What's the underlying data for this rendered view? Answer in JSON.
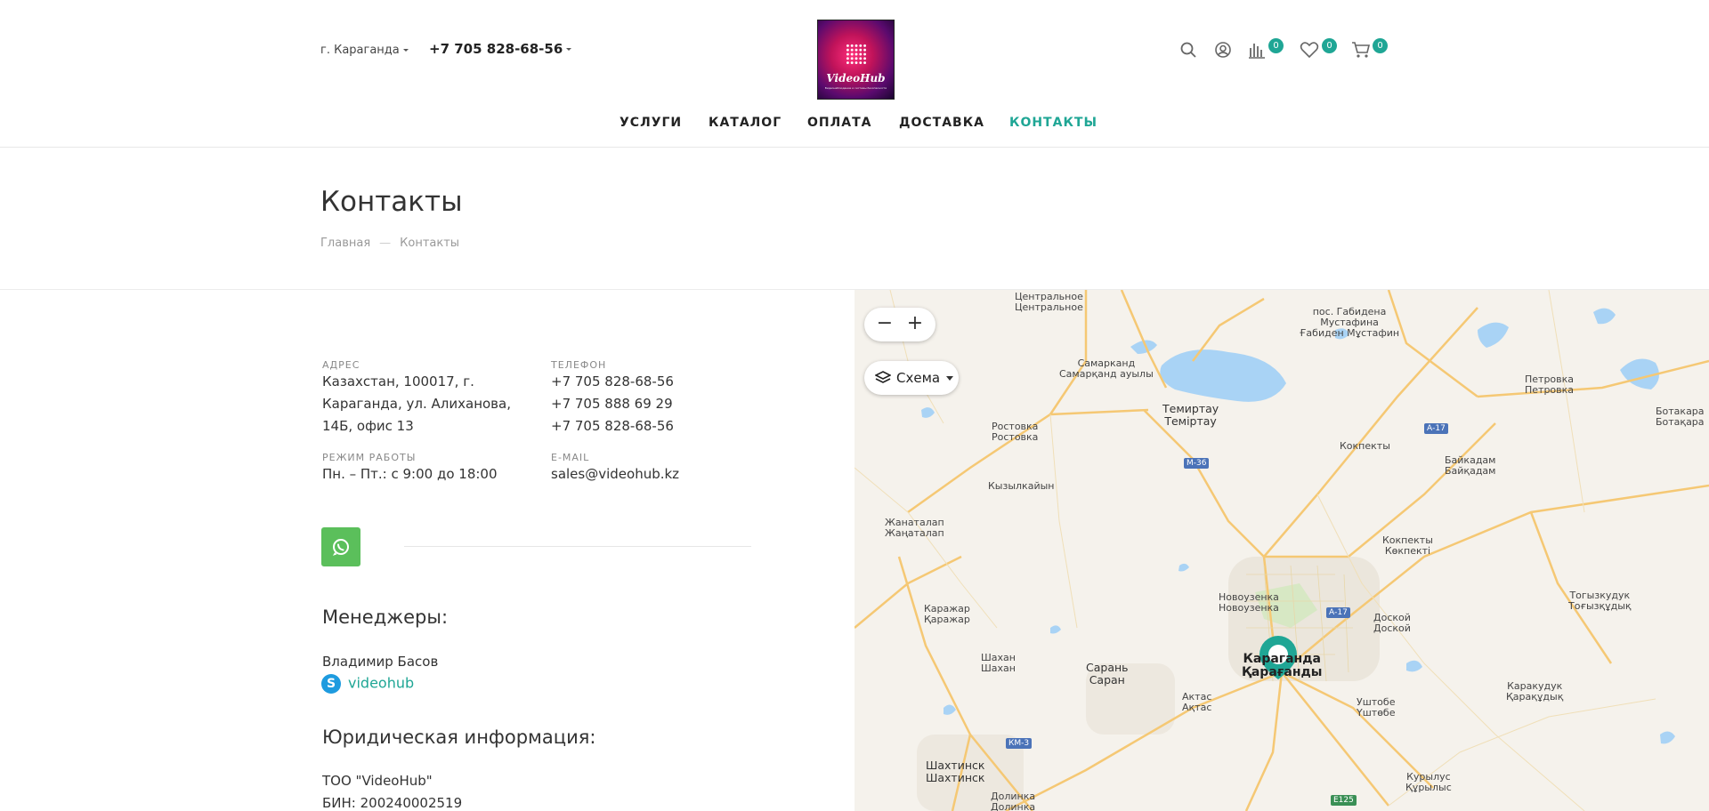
{
  "header": {
    "city": "г. Караганда",
    "phone": "+7 705 828-68-56",
    "logo_text": "VideoHub",
    "logo_subtext": "Видеонаблюдение и системы безопасности",
    "compare_count": "0",
    "favorites_count": "0",
    "cart_count": "0"
  },
  "nav": {
    "items": [
      {
        "label": "УСЛУГИ"
      },
      {
        "label": "КАТАЛОГ"
      },
      {
        "label": "ОПЛАТА"
      },
      {
        "label": "ДОСТАВКА"
      },
      {
        "label": "КОНТАКТЫ"
      }
    ],
    "active_index": 4
  },
  "page": {
    "title": "Контакты",
    "breadcrumb": [
      "Главная",
      "—",
      "Контакты"
    ]
  },
  "contacts": {
    "address_label": "АДРЕС",
    "address_lines": [
      "Казахстан, 100017, г.",
      "Караганда, ул. Алиханова,",
      "14Б, офис 13"
    ],
    "phone_label": "ТЕЛЕФОН",
    "phones": [
      "+7 705 828-68-56",
      "+7 705 888 69 29",
      "+7 705 828-68-56"
    ],
    "hours_label": "РЕЖИМ РАБОТЫ",
    "hours": "Пн. – Пт.: с 9:00 до 18:00",
    "email_label": "E-MAIL",
    "email": "sales@videohub.kz"
  },
  "managers": {
    "heading": "Менеджеры:",
    "name": "Владимир Басов",
    "skype": "videohub"
  },
  "legal": {
    "heading": "Юридическая информация:",
    "company": "ТОО \"VideoHub\"",
    "bin": "БИН: 200240002519"
  },
  "map": {
    "zoom_out": "−",
    "zoom_in": "+",
    "layer_label": "Схема",
    "labels": [
      {
        "ru": "Центральное",
        "kz": "Центральное"
      },
      {
        "ru": "пос. Габидена Мустафина",
        "kz": "Ғабиден Мұстафин"
      },
      {
        "ru": "Самарканд",
        "kz": "Самарқанд ауылы"
      },
      {
        "ru": "Темиртау",
        "kz": "Теміртау"
      },
      {
        "ru": "Петровка",
        "kz": "Петровка"
      },
      {
        "ru": "Ботакара",
        "kz": "Ботақара"
      },
      {
        "ru": "Ростовка",
        "kz": "Ростовка"
      },
      {
        "ru": "Кокпекты",
        "kz": ""
      },
      {
        "ru": "Байкадам",
        "kz": "Байқадам"
      },
      {
        "ru": "Кызылкайын",
        "kz": ""
      },
      {
        "ru": "Жанаталап",
        "kz": "Жаңаталап"
      },
      {
        "ru": "Кокпекты",
        "kz": "Көкпекті"
      },
      {
        "ru": "Новоузенка",
        "kz": "Новоузенка"
      },
      {
        "ru": "Доской",
        "kz": "Доской"
      },
      {
        "ru": "Тогызкудук",
        "kz": "Тоғызқұдық"
      },
      {
        "ru": "Каражар",
        "kz": "Қаражар"
      },
      {
        "ru": "Шахан",
        "kz": "Шахан"
      },
      {
        "ru": "Сарань",
        "kz": "Саран"
      },
      {
        "ru": "Караганда",
        "kz": "Қарағанды"
      },
      {
        "ru": "Актас",
        "kz": "Ақтас"
      },
      {
        "ru": "Уштобе",
        "kz": "Үштөбе"
      },
      {
        "ru": "Каракудук",
        "kz": "Қарақұдық"
      },
      {
        "ru": "Шахтинск",
        "kz": "Шахтинск"
      },
      {
        "ru": "Долинка",
        "kz": "Долинка"
      },
      {
        "ru": "Курылус",
        "kz": "Құрылыс"
      }
    ],
    "roads": [
      "М-36",
      "А-17",
      "А-17",
      "КМ-3",
      "E125"
    ],
    "colors": {
      "marker": "#1fa695",
      "road": "#f5c874",
      "water": "#a9d3f5"
    }
  },
  "colors": {
    "accent": "#1fa695",
    "whatsapp": "#5bbf5b",
    "skype": "#1e9bdf"
  }
}
